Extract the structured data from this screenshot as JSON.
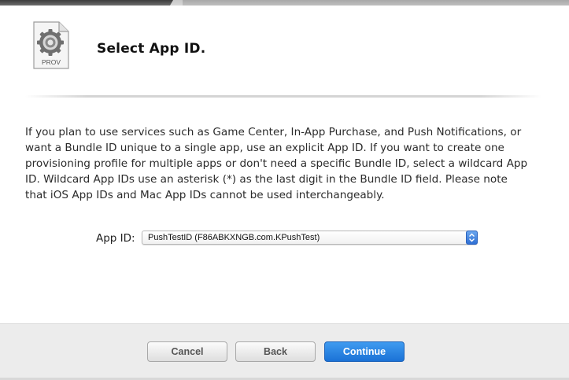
{
  "header": {
    "title": "Select App ID.",
    "file_icon": {
      "name": "provisioning-profile-icon",
      "badge": "PROV"
    }
  },
  "description": "If you plan to use services such as Game Center, In-App Purchase, and Push Notifications, or want a Bundle ID unique to a single app, use an explicit App ID. If you want to create one provisioning profile for multiple apps or don't need a specific Bundle ID, select a wildcard App ID. Wildcard App IDs use an asterisk (*) as the last digit in the Bundle ID field. Please note that iOS App IDs and Mac App IDs cannot be used interchangeably.",
  "app_id": {
    "label": "App ID:",
    "selected": "PushTestID (F86ABKXNGB.com.KPushTest)"
  },
  "buttons": {
    "cancel": "Cancel",
    "back": "Back",
    "continue": "Continue"
  },
  "colors": {
    "accent": "#1b72d6",
    "footer_bg": "#ececec"
  }
}
